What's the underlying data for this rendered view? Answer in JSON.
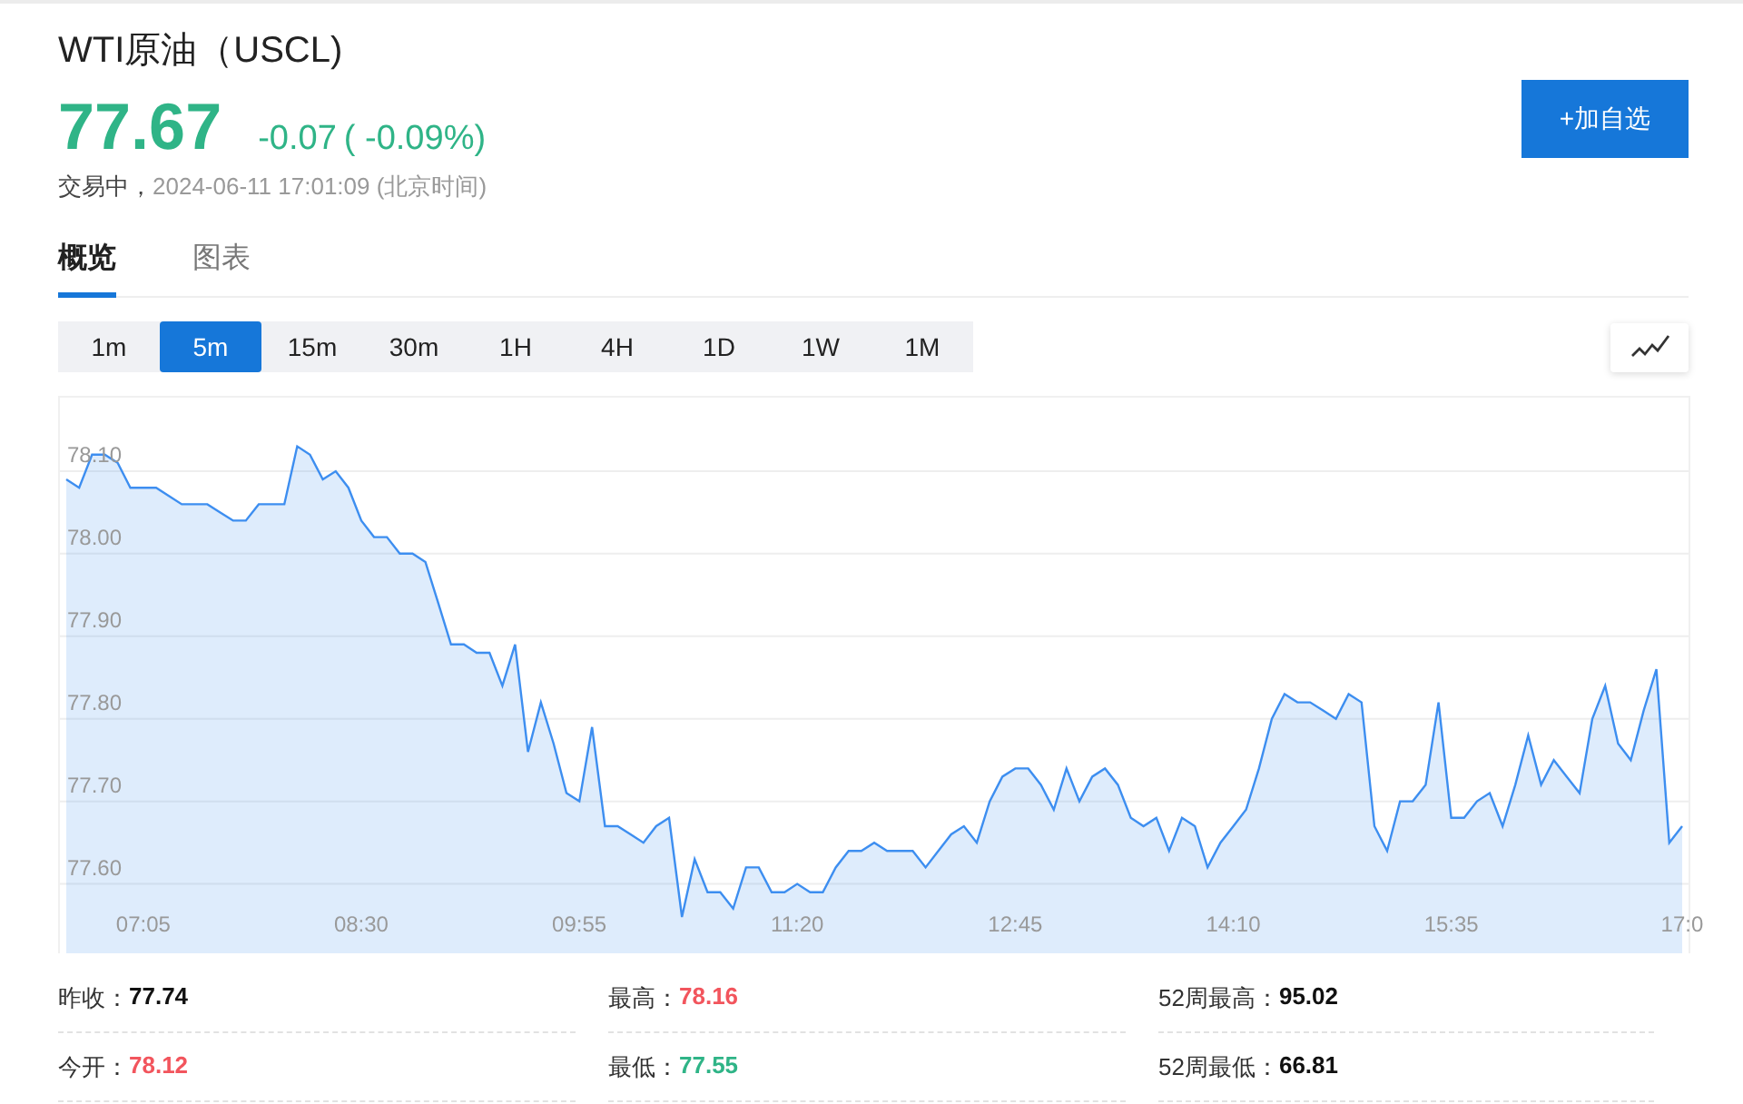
{
  "quote": {
    "title": "WTI原油（USCL)",
    "price": "77.67",
    "change": "-0.07",
    "percent": "( -0.09%)",
    "color": "#2fb487",
    "status": "交易中，",
    "timestamp": "2024-06-11 17:01:09 (北京时间)"
  },
  "watch_button": "+加自选",
  "tabs": [
    {
      "label": "概览",
      "selected": true
    },
    {
      "label": "图表",
      "selected": false
    }
  ],
  "periods": [
    {
      "label": "1m",
      "selected": false
    },
    {
      "label": "5m",
      "selected": true
    },
    {
      "label": "15m",
      "selected": false
    },
    {
      "label": "30m",
      "selected": false
    },
    {
      "label": "1H",
      "selected": false
    },
    {
      "label": "4H",
      "selected": false
    },
    {
      "label": "1D",
      "selected": false
    },
    {
      "label": "1W",
      "selected": false
    },
    {
      "label": "1M",
      "selected": false
    }
  ],
  "chart": {
    "chart_data": {
      "type": "area",
      "grid": true,
      "categories": [
        null,
        null,
        null,
        null,
        null,
        null,
        "07:05",
        null,
        null,
        null,
        null,
        null,
        null,
        null,
        null,
        null,
        null,
        null,
        null,
        null,
        null,
        null,
        null,
        "08:30",
        null,
        null,
        null,
        null,
        null,
        null,
        null,
        null,
        null,
        null,
        null,
        null,
        null,
        null,
        null,
        null,
        "09:55",
        null,
        null,
        null,
        null,
        null,
        null,
        null,
        null,
        null,
        null,
        null,
        null,
        null,
        null,
        null,
        null,
        "11:20",
        null,
        null,
        null,
        null,
        null,
        null,
        null,
        null,
        null,
        null,
        null,
        null,
        null,
        null,
        null,
        null,
        "12:45",
        null,
        null,
        null,
        null,
        null,
        null,
        null,
        null,
        null,
        null,
        null,
        null,
        null,
        null,
        null,
        null,
        "14:10",
        null,
        null,
        null,
        null,
        null,
        null,
        null,
        null,
        null,
        null,
        null,
        null,
        null,
        null,
        null,
        null,
        "15:35",
        null,
        null,
        null,
        null,
        null,
        null,
        null,
        null,
        null,
        null,
        null,
        null,
        null,
        null,
        null,
        null,
        null,
        "17:0"
      ],
      "ylim": [
        77.516,
        78.189
      ],
      "yticks": [
        {
          "value": 78.1,
          "label": "78.10"
        },
        {
          "value": 78.0,
          "label": "78.00"
        },
        {
          "value": 77.9,
          "label": "77.90"
        },
        {
          "value": 77.8,
          "label": "77.80"
        },
        {
          "value": 77.7,
          "label": "77.70"
        },
        {
          "value": 77.6,
          "label": "77.60"
        }
      ],
      "series": [
        {
          "color": "#3d8ef0",
          "values": [
            78.09,
            78.08,
            78.12,
            78.12,
            78.11,
            78.08,
            78.08,
            78.08,
            78.07,
            78.06,
            78.06,
            78.06,
            78.05,
            78.04,
            78.04,
            78.06,
            78.06,
            78.06,
            78.13,
            78.12,
            78.09,
            78.1,
            78.08,
            78.04,
            78.02,
            78.02,
            78.0,
            78.0,
            77.99,
            77.94,
            77.89,
            77.89,
            77.88,
            77.88,
            77.84,
            77.89,
            77.76,
            77.82,
            77.77,
            77.71,
            77.7,
            77.79,
            77.67,
            77.67,
            77.66,
            77.65,
            77.67,
            77.68,
            77.56,
            77.63,
            77.59,
            77.59,
            77.57,
            77.62,
            77.62,
            77.59,
            77.59,
            77.6,
            77.59,
            77.59,
            77.62,
            77.64,
            77.64,
            77.65,
            77.64,
            77.64,
            77.64,
            77.62,
            77.64,
            77.66,
            77.67,
            77.65,
            77.7,
            77.73,
            77.74,
            77.74,
            77.72,
            77.69,
            77.74,
            77.7,
            77.73,
            77.74,
            77.72,
            77.68,
            77.67,
            77.68,
            77.64,
            77.68,
            77.67,
            77.62,
            77.65,
            77.67,
            77.69,
            77.74,
            77.8,
            77.83,
            77.82,
            77.82,
            77.81,
            77.8,
            77.83,
            77.82,
            77.67,
            77.64,
            77.7,
            77.7,
            77.72,
            77.82,
            77.68,
            77.68,
            77.7,
            77.71,
            77.67,
            77.72,
            77.78,
            77.72,
            77.75,
            77.73,
            77.71,
            77.8,
            77.84,
            77.77,
            77.75,
            77.81,
            77.86,
            77.65,
            77.67
          ]
        }
      ]
    }
  },
  "stats": [
    {
      "label": "昨收：",
      "value": "77.74",
      "color": "#111111"
    },
    {
      "label": "最高：",
      "value": "78.16",
      "color": "#f2555d"
    },
    {
      "label": "52周最高：",
      "value": "95.02",
      "color": "#111111"
    },
    {
      "label": "今开：",
      "value": "78.12",
      "color": "#f2555d"
    },
    {
      "label": "最低：",
      "value": "77.55",
      "color": "#2fb487"
    },
    {
      "label": "52周最低：",
      "value": "66.81",
      "color": "#111111"
    }
  ]
}
